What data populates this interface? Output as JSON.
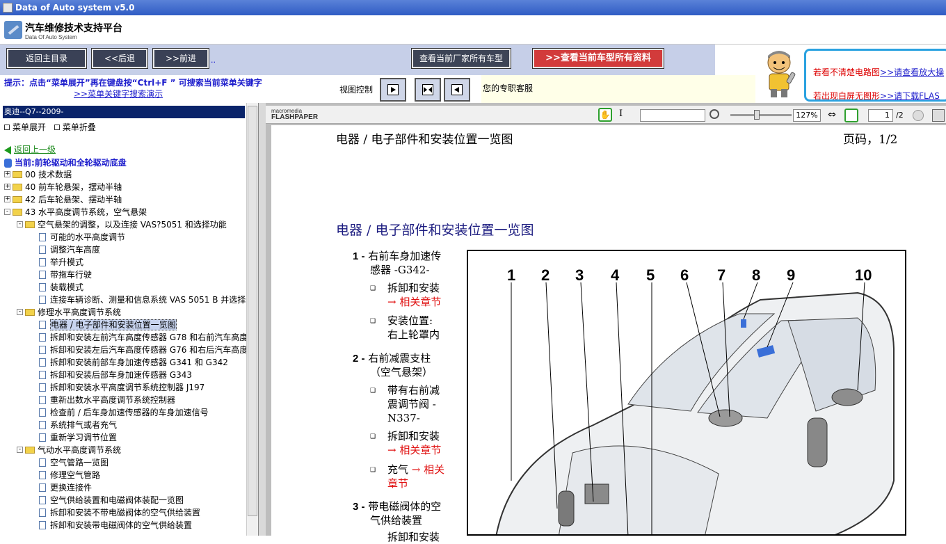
{
  "window": {
    "title": "Data of Auto system v5.0"
  },
  "app": {
    "title": "汽车维修技术支持平台",
    "subtitle": "Data Of Auto System"
  },
  "toolbar": {
    "home": "返回主目录",
    "back": "<<后退",
    "forward": ">>前进",
    "dots": "..",
    "maker_models": "查看当前厂家所有车型",
    "all_data": "查看当前车型所有资料"
  },
  "hint": {
    "line1": "提示：点击“菜单展开”再在键盘按“Ctrl+F ” 可搜索当前菜单关键字",
    "line2": ">>菜单关键字搜索演示"
  },
  "view_control": {
    "label": "视图控制"
  },
  "service": {
    "text": "您的专职客服"
  },
  "ad": {
    "line1_red": "若看不清楚电路图",
    "line1_link": ">>请查看放大操",
    "line2_red": "若出现白屏无图形",
    "line2_link": ">>请下载FLAS"
  },
  "sidebar": {
    "selected": "奥迪--Q7--2009-",
    "expand": "菜单展开",
    "collapse": "菜单折叠",
    "back_up": "返回上一级",
    "current": "当前:前轮驱动和全轮驱动底盘",
    "tree": [
      {
        "label": "00 技术数据",
        "level": 0,
        "kind": "folder",
        "pm": "+"
      },
      {
        "label": "40 前车轮悬架，摆动半轴",
        "level": 0,
        "kind": "folder",
        "pm": "+"
      },
      {
        "label": "42 后车轮悬架、摆动半轴",
        "level": 0,
        "kind": "folder",
        "pm": "+"
      },
      {
        "label": "43 水平高度调节系统，空气悬架",
        "level": 0,
        "kind": "folder",
        "pm": "-"
      },
      {
        "label": "空气悬架的调整，以及连接 VAS?5051 和选择功能",
        "level": 1,
        "kind": "folder",
        "pm": "-"
      },
      {
        "label": "可能的水平高度调节",
        "level": 2,
        "kind": "doc"
      },
      {
        "label": "调整汽车高度",
        "level": 2,
        "kind": "doc"
      },
      {
        "label": "举升模式",
        "level": 2,
        "kind": "doc"
      },
      {
        "label": "带拖车行驶",
        "level": 2,
        "kind": "doc"
      },
      {
        "label": "装载模式",
        "level": 2,
        "kind": "doc"
      },
      {
        "label": "连接车辆诊断、测量和信息系统 VAS 5051 B 并选择",
        "level": 2,
        "kind": "doc"
      },
      {
        "label": "修理水平高度调节系统",
        "level": 1,
        "kind": "folder",
        "pm": "-"
      },
      {
        "label": "电器 / 电子部件和安装位置一览图",
        "level": 2,
        "kind": "doc",
        "selected": true
      },
      {
        "label": "拆卸和安装左前汽车高度传感器 G78 和右前汽车高度",
        "level": 2,
        "kind": "doc"
      },
      {
        "label": "拆卸和安装左后汽车高度传感器 G76 和右后汽车高度",
        "level": 2,
        "kind": "doc"
      },
      {
        "label": "拆卸和安装前部车身加速传感器 G341 和 G342",
        "level": 2,
        "kind": "doc"
      },
      {
        "label": "拆卸和安装后部车身加速传感器 G343",
        "level": 2,
        "kind": "doc"
      },
      {
        "label": "拆卸和安装水平高度调节系统控制器 J197",
        "level": 2,
        "kind": "doc"
      },
      {
        "label": "重新出数水平高度调节系统控制器",
        "level": 2,
        "kind": "doc"
      },
      {
        "label": "检查前 / 后车身加速传感器的车身加速信号",
        "level": 2,
        "kind": "doc"
      },
      {
        "label": "系统排气或者充气",
        "level": 2,
        "kind": "doc"
      },
      {
        "label": "重新学习调节位置",
        "level": 2,
        "kind": "doc"
      },
      {
        "label": "气动水平高度调节系统",
        "level": 1,
        "kind": "folder",
        "pm": "-"
      },
      {
        "label": "空气管路一览图",
        "level": 2,
        "kind": "doc"
      },
      {
        "label": "修理空气管路",
        "level": 2,
        "kind": "doc"
      },
      {
        "label": "更换连接件",
        "level": 2,
        "kind": "doc"
      },
      {
        "label": "空气供给装置和电磁阀体装配一览图",
        "level": 2,
        "kind": "doc"
      },
      {
        "label": "拆卸和安装不带电磁阀体的空气供给装置",
        "level": 2,
        "kind": "doc"
      },
      {
        "label": "拆卸和安装带电磁阀体的空气供给装置",
        "level": 2,
        "kind": "doc"
      }
    ]
  },
  "flashpaper": {
    "brand_top": "macromedia",
    "brand_bottom": "FLASHPAPER",
    "zoom": "127%",
    "page": "1",
    "total": "/2"
  },
  "document": {
    "header": "电器 / 电子部件和安装位置一览图",
    "page_no": "页码，1/2",
    "title": "电器 / 电子部件和安装位置一览图",
    "items": {
      "i1_num": "1 -",
      "i1_a": "右前车身加速传",
      "i1_b": "感器 -G342-",
      "i1_s1": "拆卸和安装",
      "i1_s1_link": "→ 相关章节",
      "i1_s2": "安装位置:",
      "i1_s2b": "右上轮罩内",
      "i2_num": "2 -",
      "i2_a": "右前减震支柱",
      "i2_b": "（空气悬架）",
      "i2_s1": "带有右前减",
      "i2_s1b": "震调节阀 -",
      "i2_s1c": "N337-",
      "i2_s2": "拆卸和安装",
      "i2_s2_link": "→ 相关章节",
      "i2_s3": "充气",
      "i2_s3_link": "→ 相关",
      "i2_s3_link2": "章节",
      "i3_num": "3 -",
      "i3_a": "带电磁阀体的空",
      "i3_b": "气供给装置",
      "i3_s1": "拆卸和安装"
    },
    "figure_numbers": [
      "1",
      "2",
      "3",
      "4",
      "5",
      "6",
      "7",
      "8",
      "9",
      "10"
    ]
  },
  "colors": {
    "title_bar": "#2f5cc4",
    "toolbar": "#c6cfe8",
    "selection": "#0a246a",
    "link": "#1c1ccc",
    "accent_red": "#e01010"
  }
}
